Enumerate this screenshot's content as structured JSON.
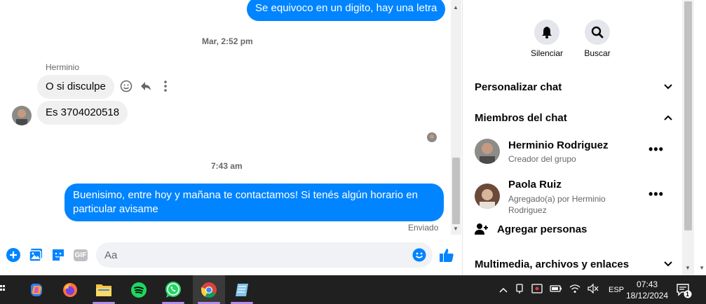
{
  "chat": {
    "messages": {
      "out1": "Se equivoco en un digito, hay una letra",
      "timestamp1": "Mar, 2:52 pm",
      "sender": "Herminio",
      "in1": "O si disculpe",
      "in2": "Es 3704020518",
      "timestamp2": "7:43 am",
      "out2": "Buenisimo, entre hoy y mañana te contactamos! Si tenés algún horario en particular avisame",
      "status": "Enviado"
    },
    "composer": {
      "placeholder": "Aa",
      "gif_label": "GIF"
    }
  },
  "side": {
    "mute_label": "Silenciar",
    "search_label": "Buscar",
    "customize_label": "Personalizar chat",
    "members_label": "Miembros del chat",
    "members": [
      {
        "name": "Herminio Rodriguez",
        "role": "Creador del grupo"
      },
      {
        "name": "Paola Ruiz",
        "role": "Agregado(a) por Herminio Rodriguez"
      }
    ],
    "more_label": "•••",
    "add_people_label": "Agregar personas",
    "media_label": "Multimedia, archivos y enlaces"
  },
  "taskbar": {
    "language": "ESP",
    "time": "07:43",
    "date": "18/12/2024",
    "notifications": "1"
  },
  "colors": {
    "accent": "#0084ff",
    "bubble_in": "#f0f0f0",
    "taskbar": "#202020"
  }
}
